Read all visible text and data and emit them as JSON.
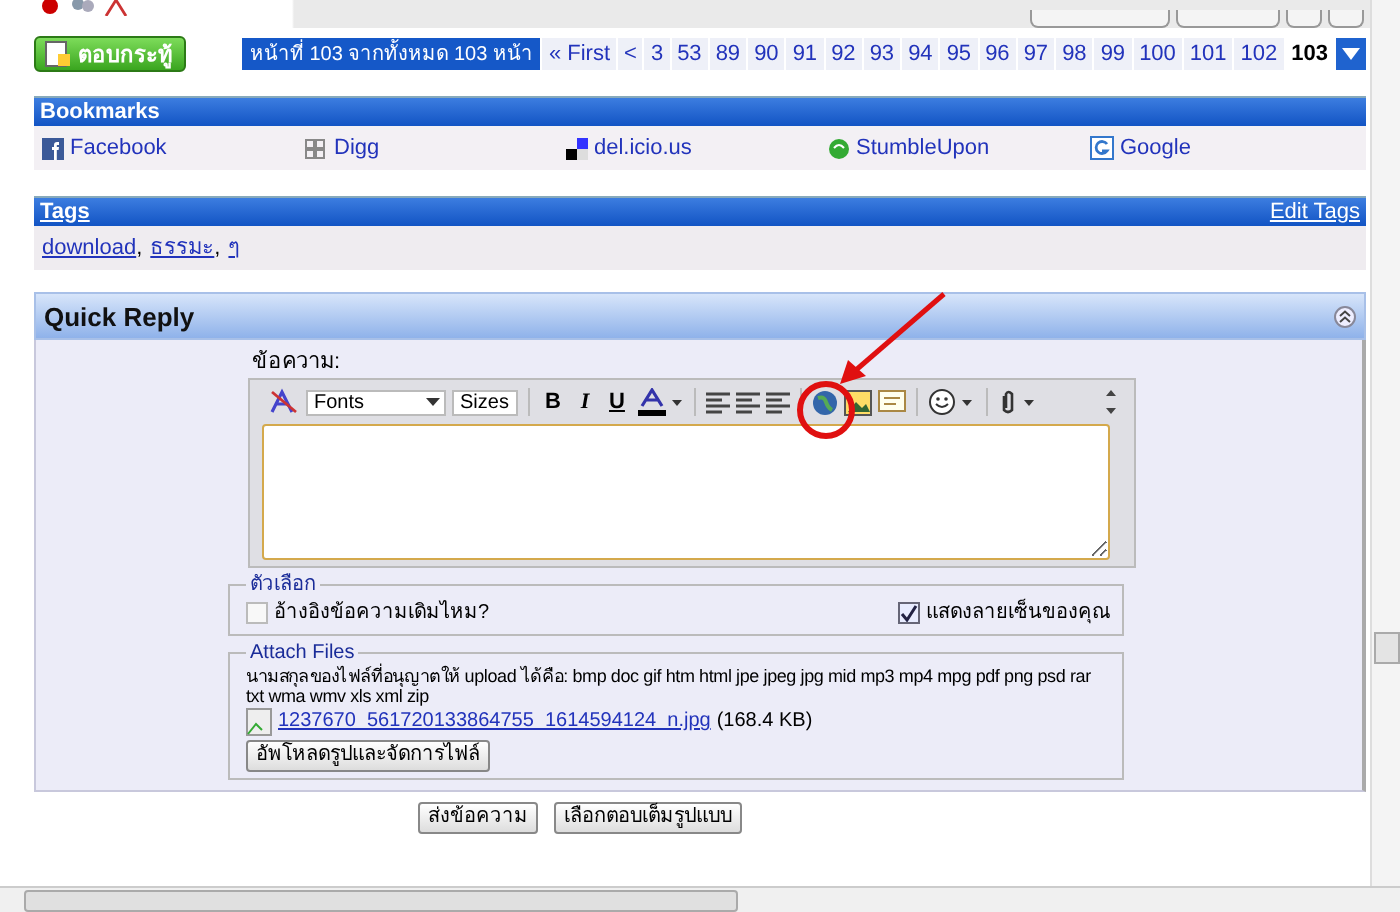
{
  "reply_button": "ตอบกระทู้",
  "pagination": {
    "summary": "หน้าที่ 103 จากทั้งหมด 103 หน้า",
    "first": "« First",
    "prev": "<",
    "pages": [
      {
        "label": "3",
        "selected": false
      },
      {
        "label": "53",
        "selected": false
      },
      {
        "label": "89",
        "selected": false
      },
      {
        "label": "90",
        "selected": false
      },
      {
        "label": "91",
        "selected": false
      },
      {
        "label": "92",
        "selected": false
      },
      {
        "label": "93",
        "selected": false
      },
      {
        "label": "94",
        "selected": false
      },
      {
        "label": "95",
        "selected": false
      },
      {
        "label": "96",
        "selected": false
      },
      {
        "label": "97",
        "selected": false
      },
      {
        "label": "98",
        "selected": false
      },
      {
        "label": "99",
        "selected": false
      },
      {
        "label": "100",
        "selected": false
      },
      {
        "label": "101",
        "selected": false
      },
      {
        "label": "102",
        "selected": false
      },
      {
        "label": "103",
        "selected": true
      }
    ]
  },
  "bookmarks": {
    "title": "Bookmarks",
    "items": [
      {
        "label": "Facebook",
        "kind": "facebook"
      },
      {
        "label": "Digg",
        "kind": "digg"
      },
      {
        "label": "del.icio.us",
        "kind": "delicious"
      },
      {
        "label": "StumbleUpon",
        "kind": "stumble"
      },
      {
        "label": "Google",
        "kind": "google"
      }
    ]
  },
  "tags": {
    "title": "Tags",
    "edit": "Edit Tags",
    "items": [
      "download",
      "ธรรมะ",
      "ๆ"
    ],
    "separator": ","
  },
  "quick_reply": {
    "title": "Quick Reply",
    "message_label": "ข้อความ:",
    "toolbar": {
      "font": "Fonts",
      "size": "Sizes",
      "format": [
        "B",
        "I",
        "U"
      ]
    },
    "options": {
      "legend": "ตัวเลือก",
      "items": [
        {
          "label": "อ้างอิงข้อความเดิมไหม?",
          "checked": false
        },
        {
          "label": "แสดงลายเซ็นของคุณ",
          "checked": true
        }
      ]
    },
    "attach": {
      "legend": "Attach Files",
      "note": "นามสกุลของไฟล์ที่อนุญาตให้ upload ได้คือ: bmp doc gif htm html jpe jpeg jpg mid mp3 mp4 mpg pdf png psd rar txt wma wmv xls xml zip",
      "file": "1237670_561720133864755_1614594124_n.jpg",
      "size": "(168.4 KB)",
      "manage_button": "อัพโหลดรูปและจัดการไฟล์"
    },
    "buttons": [
      "ส่งข้อความ",
      "เลือกตอบเต็มรูปแบบ"
    ]
  }
}
